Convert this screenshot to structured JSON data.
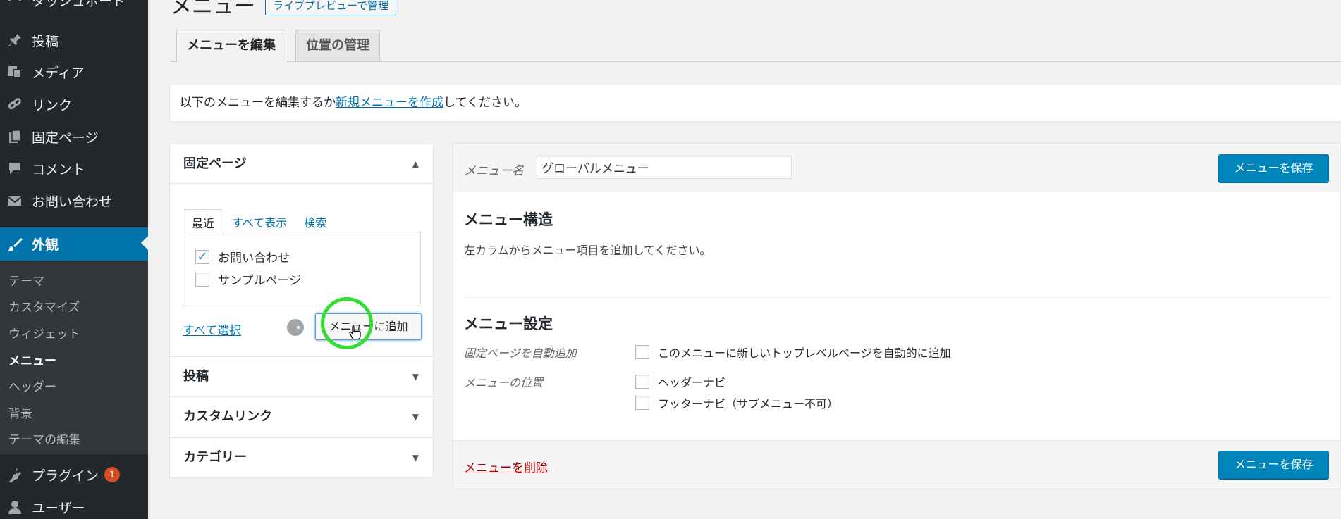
{
  "sidebar": {
    "items": [
      {
        "label": "ダッシュボード",
        "icon": "dashboard-icon"
      },
      {
        "label": "投稿",
        "icon": "pin-icon"
      },
      {
        "label": "メディア",
        "icon": "media-icon"
      },
      {
        "label": "リンク",
        "icon": "link-icon"
      },
      {
        "label": "固定ページ",
        "icon": "pages-icon"
      },
      {
        "label": "コメント",
        "icon": "comment-icon"
      },
      {
        "label": "お問い合わせ",
        "icon": "mail-icon"
      },
      {
        "label": "外観",
        "icon": "brush-icon"
      },
      {
        "label": "プラグイン",
        "icon": "plugin-icon",
        "badge": "1"
      },
      {
        "label": "ユーザー",
        "icon": "user-icon"
      }
    ],
    "submenu": [
      "テーマ",
      "カスタマイズ",
      "ウィジェット",
      "メニュー",
      "ヘッダー",
      "背景",
      "テーマの編集"
    ]
  },
  "header": {
    "title": "メニュー",
    "live_preview": "ライブプレビューで管理"
  },
  "tabs": [
    "メニューを編集",
    "位置の管理"
  ],
  "notice": {
    "before": "以下のメニューを編集するか",
    "link": "新規メニューを作成",
    "after": "してください。"
  },
  "left": {
    "pages_title": "固定ページ",
    "inner_tabs": [
      "最近",
      "すべて表示",
      "検索"
    ],
    "pages": [
      {
        "label": "お問い合わせ",
        "checked": true
      },
      {
        "label": "サンプルページ",
        "checked": false
      }
    ],
    "select_all": "すべて選択",
    "add_button": "メニューに追加",
    "sections": [
      "投稿",
      "カスタムリンク",
      "カテゴリー"
    ]
  },
  "right": {
    "menu_name_label": "メニュー名",
    "menu_name_value": "グローバルメニュー",
    "save_label": "メニューを保存",
    "structure_title": "メニュー構造",
    "structure_desc": "左カラムからメニュー項目を追加してください。",
    "settings_title": "メニュー設定",
    "auto_add_label": "固定ページを自動追加",
    "auto_add_option": "このメニューに新しいトップレベルページを自動的に追加",
    "location_label": "メニューの位置",
    "locations": [
      "ヘッダーナビ",
      "フッターナビ（サブメニュー不可）"
    ],
    "delete_label": "メニューを削除"
  },
  "colors": {
    "sidebar_bg": "#23282d",
    "accent": "#0073aa",
    "button_primary": "#0085ba",
    "delete": "#aa0000",
    "click_ring": "#33dd33"
  }
}
